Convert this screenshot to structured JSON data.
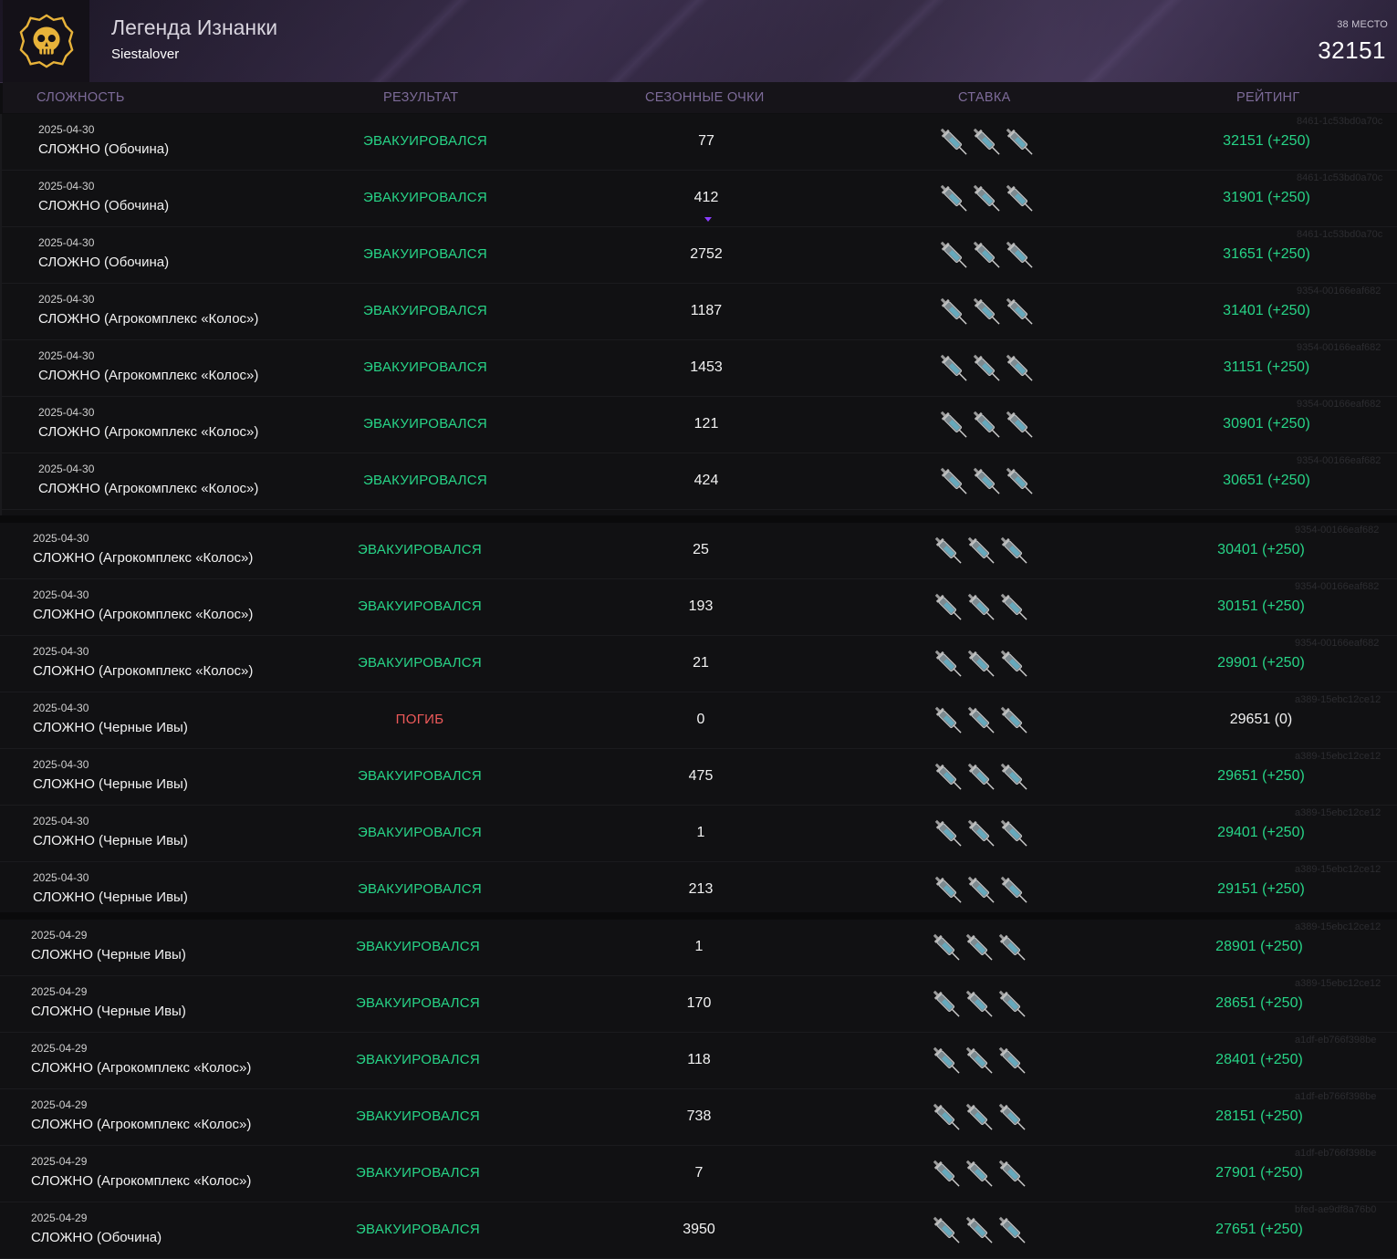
{
  "header": {
    "title": "Легенда Изнанки",
    "player": "Siestalover",
    "place": "38 МЕСТО",
    "score": "32151"
  },
  "columns": {
    "difficulty": "СЛОЖНОСТЬ",
    "result": "РЕЗУЛЬТАТ",
    "points": "СЕЗОННЫЕ ОЧКИ",
    "stake": "СТАВКА",
    "rating": "РЕЙТИНГ"
  },
  "icons": {
    "emblem": "skull-emblem-icon",
    "stake": "syringe-icon"
  },
  "colors": {
    "accent_purple": "#7d6b99",
    "evacuated": "#27d487",
    "died": "#ef5a5a"
  },
  "rows": [
    {
      "date": "2025-04-30",
      "difficulty": "СЛОЖНО (Обочина)",
      "result": "ЭВАКУИРОВАЛСЯ",
      "points": "77",
      "rating": "32151 (+250)",
      "match_id": "8461-1c53bd0a70c"
    },
    {
      "date": "2025-04-30",
      "difficulty": "СЛОЖНО (Обочина)",
      "result": "ЭВАКУИРОВАЛСЯ",
      "points": "412",
      "rating": "31901 (+250)",
      "match_id": "8461-1c53bd0a70c"
    },
    {
      "date": "2025-04-30",
      "difficulty": "СЛОЖНО (Обочина)",
      "result": "ЭВАКУИРОВАЛСЯ",
      "points": "2752",
      "rating": "31651 (+250)",
      "match_id": "8461-1c53bd0a70c"
    },
    {
      "date": "2025-04-30",
      "difficulty": "СЛОЖНО (Агрокомплекс «Колос»)",
      "result": "ЭВАКУИРОВАЛСЯ",
      "points": "1187",
      "rating": "31401 (+250)",
      "match_id": "9354-00166eaf682"
    },
    {
      "date": "2025-04-30",
      "difficulty": "СЛОЖНО (Агрокомплекс «Колос»)",
      "result": "ЭВАКУИРОВАЛСЯ",
      "points": "1453",
      "rating": "31151 (+250)",
      "match_id": "9354-00166eaf682"
    },
    {
      "date": "2025-04-30",
      "difficulty": "СЛОЖНО (Агрокомплекс «Колос»)",
      "result": "ЭВАКУИРОВАЛСЯ",
      "points": "121",
      "rating": "30901 (+250)",
      "match_id": "9354-00166eaf682"
    },
    {
      "date": "2025-04-30",
      "difficulty": "СЛОЖНО (Агрокомплекс «Колос»)",
      "result": "ЭВАКУИРОВАЛСЯ",
      "points": "424",
      "rating": "30651 (+250)",
      "match_id": "9354-00166eaf682"
    },
    {
      "date": "2025-04-30",
      "difficulty": "СЛОЖНО (Агрокомплекс «Колос»)",
      "result": "ЭВАКУИРОВАЛСЯ",
      "points": "25",
      "rating": "30401 (+250)",
      "match_id": "9354-00166eaf682"
    },
    {
      "date": "2025-04-30",
      "difficulty": "СЛОЖНО (Агрокомплекс «Колос»)",
      "result": "ЭВАКУИРОВАЛСЯ",
      "points": "193",
      "rating": "30151 (+250)",
      "match_id": "9354-00166eaf682"
    },
    {
      "date": "2025-04-30",
      "difficulty": "СЛОЖНО (Агрокомплекс «Колос»)",
      "result": "ЭВАКУИРОВАЛСЯ",
      "points": "21",
      "rating": "29901 (+250)",
      "match_id": "9354-00166eaf682"
    },
    {
      "date": "2025-04-30",
      "difficulty": "СЛОЖНО (Черные Ивы)",
      "result": "ПОГИБ",
      "points": "0",
      "rating": "29651 (0)",
      "match_id": "a389-15ebc12ce12"
    },
    {
      "date": "2025-04-30",
      "difficulty": "СЛОЖНО (Черные Ивы)",
      "result": "ЭВАКУИРОВАЛСЯ",
      "points": "475",
      "rating": "29651 (+250)",
      "match_id": "a389-15ebc12ce12"
    },
    {
      "date": "2025-04-30",
      "difficulty": "СЛОЖНО (Черные Ивы)",
      "result": "ЭВАКУИРОВАЛСЯ",
      "points": "1",
      "rating": "29401 (+250)",
      "match_id": "a389-15ebc12ce12"
    },
    {
      "date": "2025-04-30",
      "difficulty": "СЛОЖНО (Черные Ивы)",
      "result": "ЭВАКУИРОВАЛСЯ",
      "points": "213",
      "rating": "29151 (+250)",
      "match_id": "a389-15ebc12ce12"
    },
    {
      "date": "2025-04-29",
      "difficulty": "СЛОЖНО (Черные Ивы)",
      "result": "ЭВАКУИРОВАЛСЯ",
      "points": "1",
      "rating": "28901 (+250)",
      "match_id": "a389-15ebc12ce12"
    },
    {
      "date": "2025-04-29",
      "difficulty": "СЛОЖНО (Черные Ивы)",
      "result": "ЭВАКУИРОВАЛСЯ",
      "points": "170",
      "rating": "28651 (+250)",
      "match_id": "a389-15ebc12ce12"
    },
    {
      "date": "2025-04-29",
      "difficulty": "СЛОЖНО (Агрокомплекс «Колос»)",
      "result": "ЭВАКУИРОВАЛСЯ",
      "points": "118",
      "rating": "28401 (+250)",
      "match_id": "a1df-eb766f398be"
    },
    {
      "date": "2025-04-29",
      "difficulty": "СЛОЖНО (Агрокомплекс «Колос»)",
      "result": "ЭВАКУИРОВАЛСЯ",
      "points": "738",
      "rating": "28151 (+250)",
      "match_id": "a1df-eb766f398be"
    },
    {
      "date": "2025-04-29",
      "difficulty": "СЛОЖНО (Агрокомплекс «Колос»)",
      "result": "ЭВАКУИРОВАЛСЯ",
      "points": "7",
      "rating": "27901 (+250)",
      "match_id": "a1df-eb766f398be"
    },
    {
      "date": "2025-04-29",
      "difficulty": "СЛОЖНО (Обочина)",
      "result": "ЭВАКУИРОВАЛСЯ",
      "points": "3950",
      "rating": "27651 (+250)",
      "match_id": "bfed-ae9df8a76b0"
    }
  ]
}
